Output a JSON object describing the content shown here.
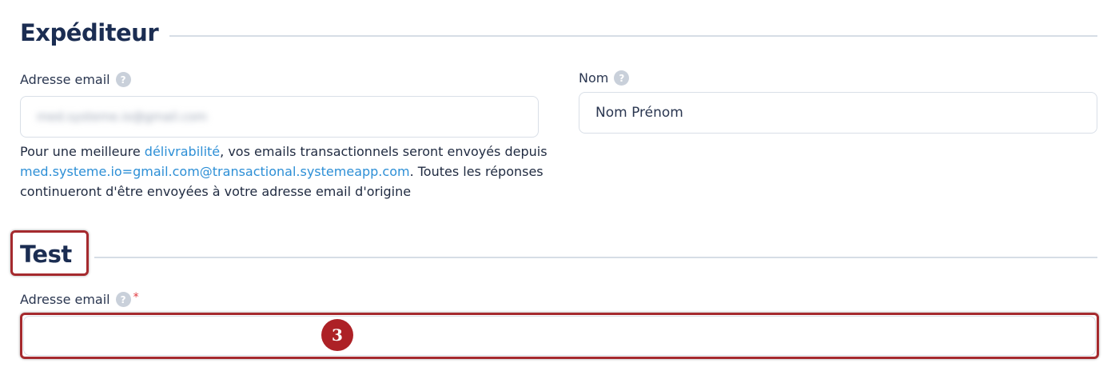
{
  "sender_section": {
    "title": "Expéditeur",
    "email": {
      "label": "Adresse email",
      "help_icon": "question-mark-icon",
      "value": "med.systeme.io@gmail.com"
    },
    "name": {
      "label": "Nom",
      "help_icon": "question-mark-icon",
      "value": "Nom Prénom"
    },
    "deliverability_note": {
      "text_1": "Pour une meilleure ",
      "link_1": "délivrabilité",
      "text_2": ", vos emails transactionnels seront envoyés depuis ",
      "link_2": "med.systeme.io=gmail.com@transactional.systemeapp.com",
      "text_3": ". Toutes les réponses continueront d'être envoyées à votre adresse email d'origine"
    }
  },
  "test_section": {
    "title": "Test",
    "email": {
      "label": "Adresse email",
      "help_icon": "question-mark-icon",
      "required_mark": "*",
      "value": ""
    }
  },
  "annotation": {
    "step_number": "3",
    "color": "#a52a2e"
  },
  "colors": {
    "heading": "#1b2d52",
    "link": "#2d8fd6",
    "required": "#e0383e",
    "highlight": "#a52a2e"
  }
}
